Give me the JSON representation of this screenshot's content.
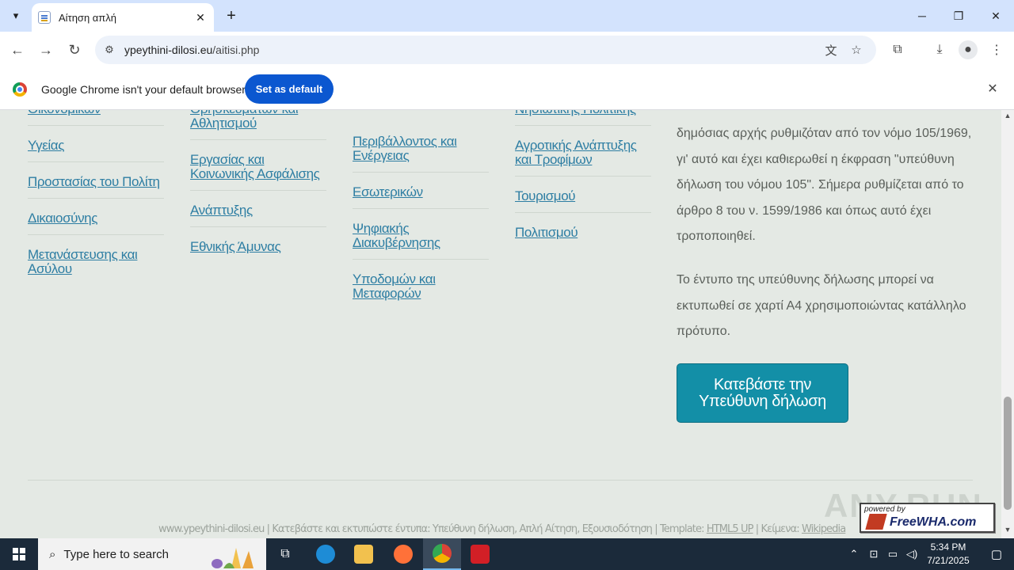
{
  "browser": {
    "tab_title": "Αίτηση απλή",
    "tab_close": "✕",
    "new_tab": "+",
    "url_domain": "ypeythini-dilosi.eu",
    "url_path": "/aitisi.php",
    "window_controls": {
      "minimize": "─",
      "restore": "❐",
      "close": "✕"
    },
    "icons": [
      "tab-search-icon",
      "back-icon",
      "forward-icon",
      "reload-icon",
      "site-info-icon",
      "translate-icon",
      "bookmark-star-icon",
      "extensions-icon",
      "downloads-icon",
      "profile-icon",
      "menu-icon"
    ]
  },
  "infobar": {
    "message": "Google Chrome isn't your default browser",
    "button": "Set as default",
    "close": "✕"
  },
  "ministries": {
    "col1": [
      "Οικονομικών",
      "Υγείας",
      "Προστασίας του Πολίτη",
      "Δικαιοσύνης",
      "Μετανάστευσης και Ασύλου"
    ],
    "col2": [
      "Θρησκευμάτων και Αθλητισμού",
      "Εργασίας και Κοινωνικής Ασφάλισης",
      "Ανάπτυξης",
      "Εθνικής Άμυνας"
    ],
    "col3": [
      "Περιβάλλοντος και Ενέργειας",
      "Εσωτερικών",
      "Ψηφιακής Διακυβέρνησης",
      "Υποδομών και Μεταφορών"
    ],
    "col4": [
      "Νησιωτικής Πολιτικής",
      "Αγροτικής Ανάπτυξης και Τροφίμων",
      "Τουρισμού",
      "Πολιτισμού"
    ]
  },
  "info": {
    "paragraph1": "δημόσιας αρχής ρυθμιζόταν από τον νόμο 105/1969, γι' αυτό και έχει καθιερωθεί η έκφραση \"υπεύθυνη δήλωση του νόμου 105\". Σήμερα ρυθμίζεται από το άρθρο 8 του ν. 1599/1986 και όπως αυτό έχει τροποποιηθεί.",
    "paragraph2": "Το έντυπο της υπεύθυνης δήλωσης μπορεί να εκτυπωθεί σε χαρτί Α4 χρησιμοποιώντας κατάλληλο πρότυπο.",
    "download_button": "Κατεβάστε την Υπεύθυνη δήλωση"
  },
  "footer": {
    "text_main": "www.ypeythini-dilosi.eu | Κατεβάστε και εκτυπώστε έντυπα: Υπεύθυνη δήλωση, Απλή Αίτηση, Εξουσιοδότηση | Template: ",
    "template_link": "HTML5 UP",
    "text_sep": " | Κείμενα: ",
    "wiki_link": "Wikipedia",
    "powered_by": "powered by",
    "host_name": "FreeWHA.com",
    "watermark": "ANY.RUN"
  },
  "taskbar": {
    "search_placeholder": "Type here to search",
    "time": "5:34 PM",
    "date": "7/21/2025",
    "apps": [
      "task-view-icon",
      "edge-icon",
      "file-explorer-icon",
      "firefox-icon",
      "chrome-icon",
      "acrobat-icon"
    ],
    "colors": {
      "edge": "#1e8cd6",
      "explorer": "#f2c14e",
      "firefox": "#ff7139",
      "chrome": "#34a853",
      "acrobat": "#d21f26"
    }
  }
}
